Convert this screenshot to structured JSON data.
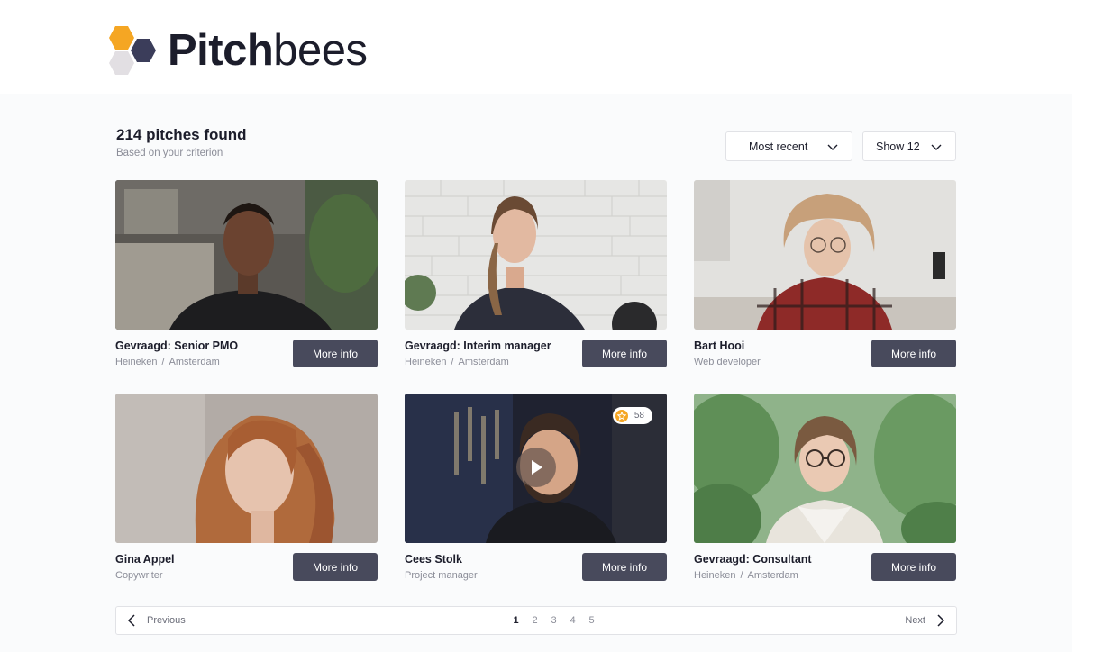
{
  "brand": {
    "logo_bold": "Pitch",
    "logo_light": "bees"
  },
  "results": {
    "title": "214 pitches found",
    "subtitle": "Based on your criterion"
  },
  "filters": {
    "sort_label": "Most recent",
    "show_label": "Show 12"
  },
  "cards": [
    {
      "title": "Gevraagd: Senior PMO",
      "company": "Heineken",
      "location": "Amsterdam",
      "button": "More info"
    },
    {
      "title": "Gevraagd: Interim manager",
      "company": "Heineken",
      "location": "Amsterdam",
      "button": "More info"
    },
    {
      "title": "Bart Hooi",
      "subtitle": "Web developer",
      "button": "More info"
    },
    {
      "title": "Gina Appel",
      "subtitle": "Copywriter",
      "button": "More info"
    },
    {
      "title": "Cees Stolk",
      "subtitle": "Project manager",
      "button": "More info",
      "rating_count": "58"
    },
    {
      "title": "Gevraagd: Consultant",
      "company": "Heineken",
      "location": "Amsterdam",
      "button": "More info"
    }
  ],
  "pagination": {
    "previous": "Previous",
    "next": "Next",
    "pages": [
      "1",
      "2",
      "3",
      "4",
      "5"
    ],
    "current": "1"
  },
  "colors": {
    "accent": "#f5a623",
    "button": "#484a5c",
    "navy": "#3b3d5a",
    "text": "#1c1d2b",
    "muted": "#8b8d98"
  }
}
